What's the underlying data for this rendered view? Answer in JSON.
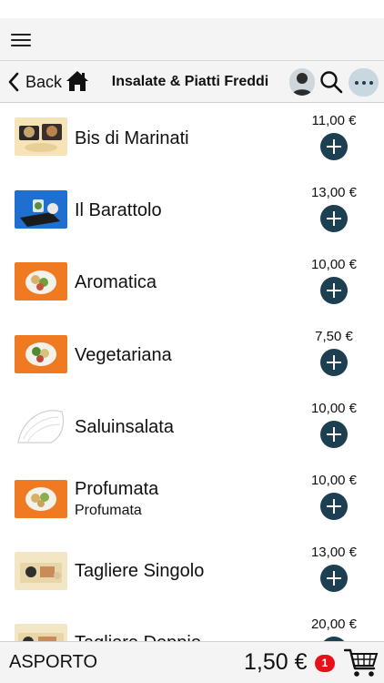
{
  "navigation": {
    "back_label": "Back",
    "title": "Insalate & Piatti Freddi"
  },
  "products": [
    {
      "name": "Bis di Marinati",
      "subtitle": "",
      "price": "11,00 €",
      "image": "marinated-dishes-photo"
    },
    {
      "name": "Il Barattolo",
      "subtitle": "",
      "price": "13,00 €",
      "image": "jar-salad-photo"
    },
    {
      "name": "Aromatica",
      "subtitle": "",
      "price": "10,00 €",
      "image": "salad-bowl-photo"
    },
    {
      "name": "Vegetariana",
      "subtitle": "",
      "price": "7,50 €",
      "image": "salad-bowl-photo"
    },
    {
      "name": "Saluinsalata",
      "subtitle": "",
      "price": "10,00 €",
      "image": "placeholder-sketch"
    },
    {
      "name": "Profumata",
      "subtitle": "Profumata",
      "price": "10,00 €",
      "image": "salad-bowl-photo"
    },
    {
      "name": "Tagliere Singolo",
      "subtitle": "",
      "price": "13,00 €",
      "image": "cutting-board-photo"
    },
    {
      "name": "Tagliere Doppio",
      "subtitle": "",
      "price": "20,00 €",
      "image": "cutting-board-photo"
    }
  ],
  "footer": {
    "order_type": "ASPORTO",
    "total": "1,50 €",
    "cart_count": "1"
  },
  "colors": {
    "add_button": "#1c3f52",
    "badge": "#e3121b",
    "bar_background": "#f4f4f4",
    "more_button": "#c9d7e0"
  }
}
